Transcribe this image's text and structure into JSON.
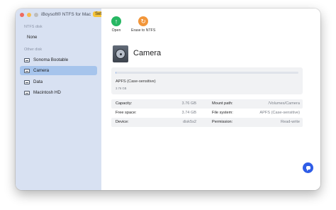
{
  "app": {
    "title": "iBoysoft® NTFS for Mac",
    "badge": "Setapp"
  },
  "sidebar": {
    "ntfs_section_label": "NTFS disk",
    "ntfs_empty_text": "None",
    "other_section_label": "Other disk",
    "items": [
      {
        "label": "Sonoma Bootable",
        "icon": "disk-icon",
        "selected": false
      },
      {
        "label": "Camera",
        "icon": "disk-icon",
        "selected": true
      },
      {
        "label": "Data",
        "icon": "disk-icon",
        "selected": false
      },
      {
        "label": "Macintosh HD",
        "icon": "disk-icon",
        "selected": false
      }
    ]
  },
  "toolbar": {
    "open_label": "Open",
    "erase_label": "Erase to NTFS"
  },
  "disk": {
    "name": "Camera",
    "fs_type": "APFS (Case-sensitive)",
    "size": "3.76 GB",
    "usage_fraction": 0.005
  },
  "info": {
    "capacity_label": "Capacity:",
    "capacity_value": "3.76 GB",
    "mount_label": "Mount path:",
    "mount_value": "/Volumes/Camera",
    "free_label": "Free space:",
    "free_value": "3.74 GB",
    "fs_label": "File system:",
    "fs_value": "APFS (Case-sensitive)",
    "device_label": "Device:",
    "device_value": "disk5s2",
    "permission_label": "Permission:",
    "permission_value": "Read-write"
  },
  "colors": {
    "sidebar_bg": "#d8e1f2",
    "selection": "#a6c4ec",
    "open_icon": "#27b763",
    "erase_icon": "#f2963a",
    "chat_button": "#2f5de7"
  }
}
